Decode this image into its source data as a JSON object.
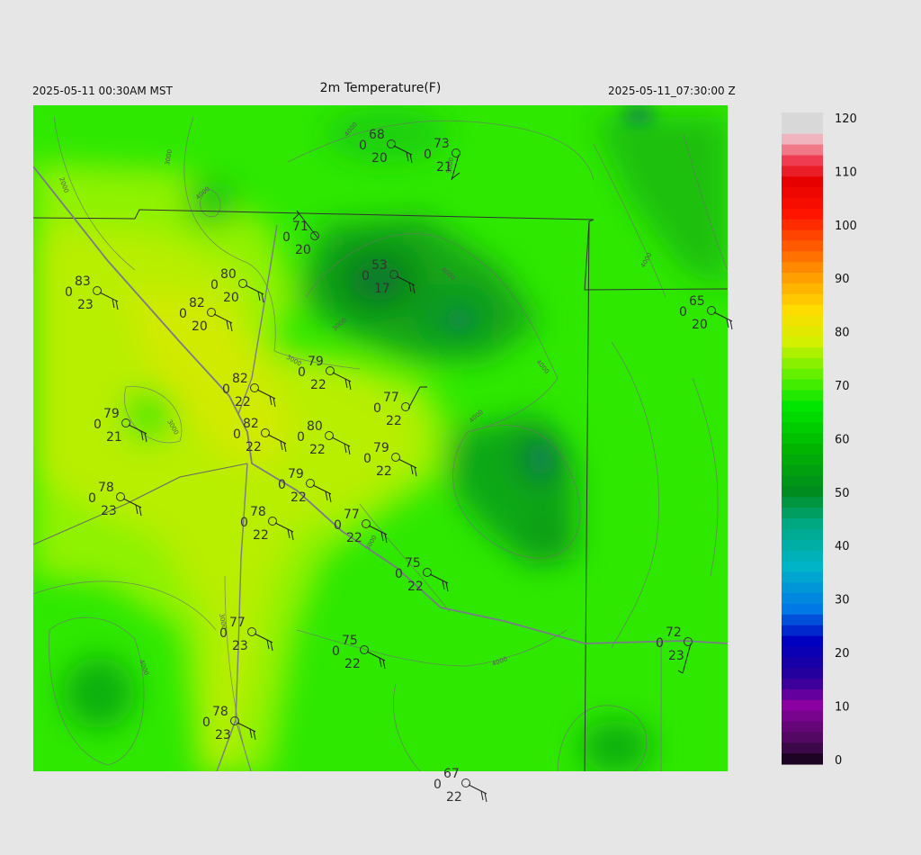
{
  "header": {
    "local_time": "2025-05-11 00:30AM MST",
    "title": "2m Temperature(F)",
    "utc_time": "2025-05-11_07:30:00 Z"
  },
  "colorbar": {
    "labels": [
      "120",
      "110",
      "100",
      "90",
      "80",
      "70",
      "60",
      "50",
      "40",
      "30",
      "20",
      "10",
      "0"
    ],
    "stops": [
      {
        "value": 0,
        "color": "#000000"
      },
      {
        "value": 5,
        "color": "#4a0a5a"
      },
      {
        "value": 12,
        "color": "#8a00a0"
      },
      {
        "value": 17,
        "color": "#2a0098"
      },
      {
        "value": 24,
        "color": "#0000c0"
      },
      {
        "value": 30,
        "color": "#0078e6"
      },
      {
        "value": 38,
        "color": "#00b4c8"
      },
      {
        "value": 46,
        "color": "#00a882"
      },
      {
        "value": 52,
        "color": "#008c1e"
      },
      {
        "value": 60,
        "color": "#00b400"
      },
      {
        "value": 68,
        "color": "#00e600"
      },
      {
        "value": 74,
        "color": "#64f000"
      },
      {
        "value": 80,
        "color": "#d2f000"
      },
      {
        "value": 86,
        "color": "#ffdc00"
      },
      {
        "value": 92,
        "color": "#ffa000"
      },
      {
        "value": 98,
        "color": "#ff5a00"
      },
      {
        "value": 104,
        "color": "#ff1400"
      },
      {
        "value": 110,
        "color": "#e60000"
      },
      {
        "value": 114,
        "color": "#f03c50"
      },
      {
        "value": 118,
        "color": "#f0b4be"
      },
      {
        "value": 120,
        "color": "#d8d8d8"
      }
    ]
  },
  "contours": [
    {
      "label": "2000"
    },
    {
      "label": "3000"
    },
    {
      "label": "4000"
    },
    {
      "label": "3000"
    },
    {
      "label": "4000"
    },
    {
      "label": "4000"
    },
    {
      "label": "3000"
    },
    {
      "label": "5000"
    },
    {
      "label": "4000"
    },
    {
      "label": "4000"
    },
    {
      "label": "4000"
    },
    {
      "label": "3000"
    },
    {
      "label": "4000"
    },
    {
      "label": "3000"
    },
    {
      "label": "3000"
    },
    {
      "label": "4000"
    }
  ],
  "stations": [
    {
      "temp": "68",
      "cloud": "0",
      "dew": "20"
    },
    {
      "temp": "73",
      "cloud": "0",
      "dew": "21"
    },
    {
      "temp": "71",
      "cloud": "0",
      "dew": "20"
    },
    {
      "temp": "53",
      "cloud": "0",
      "dew": "17"
    },
    {
      "temp": "83",
      "cloud": "0",
      "dew": "23"
    },
    {
      "temp": "80",
      "cloud": "0",
      "dew": "20"
    },
    {
      "temp": "82",
      "cloud": "0",
      "dew": "20"
    },
    {
      "temp": "65",
      "cloud": "0",
      "dew": "20"
    },
    {
      "temp": "79",
      "cloud": "0",
      "dew": "22"
    },
    {
      "temp": "82",
      "cloud": "0",
      "dew": "22"
    },
    {
      "temp": "77",
      "cloud": "0",
      "dew": "22"
    },
    {
      "temp": "79",
      "cloud": "0",
      "dew": "21"
    },
    {
      "temp": "82",
      "cloud": "0",
      "dew": "22"
    },
    {
      "temp": "80",
      "cloud": "0",
      "dew": "22"
    },
    {
      "temp": "79",
      "cloud": "0",
      "dew": "22"
    },
    {
      "temp": "78",
      "cloud": "0",
      "dew": "23"
    },
    {
      "temp": "79",
      "cloud": "0",
      "dew": "22"
    },
    {
      "temp": "78",
      "cloud": "0",
      "dew": "22"
    },
    {
      "temp": "77",
      "cloud": "0",
      "dew": "22"
    },
    {
      "temp": "75",
      "cloud": "0",
      "dew": "22"
    },
    {
      "temp": "77",
      "cloud": "0",
      "dew": "23"
    },
    {
      "temp": "75",
      "cloud": "0",
      "dew": "22"
    },
    {
      "temp": "72",
      "cloud": "0",
      "dew": "23"
    },
    {
      "temp": "78",
      "cloud": "0",
      "dew": "23"
    },
    {
      "temp": "67",
      "cloud": "0",
      "dew": "22"
    }
  ]
}
